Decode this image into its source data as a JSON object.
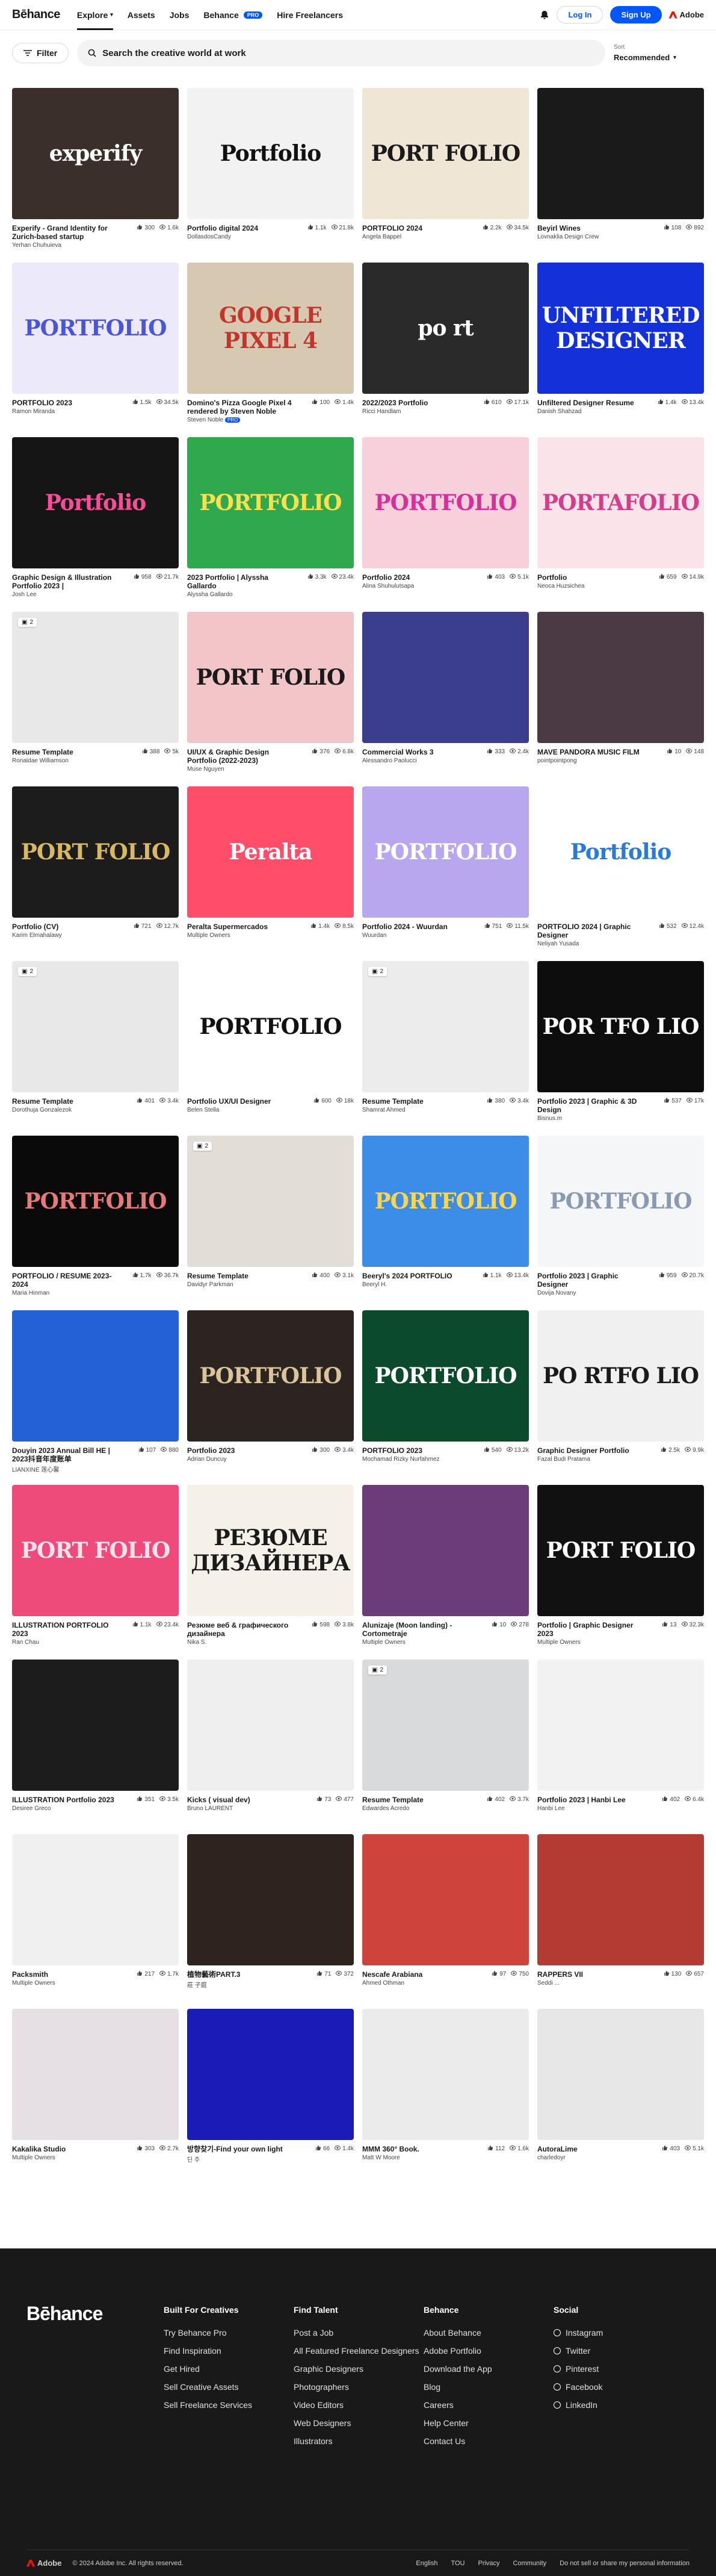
{
  "header": {
    "logo": "Bēhance",
    "nav": [
      {
        "label": "Explore",
        "active": true
      },
      {
        "label": "Assets"
      },
      {
        "label": "Jobs"
      },
      {
        "label": "Behance",
        "badge": "PRO"
      },
      {
        "label": "Hire Freelancers"
      }
    ],
    "login": "Log In",
    "signup": "Sign Up",
    "adobe": "Adobe"
  },
  "search": {
    "filter": "Filter",
    "placeholder": "Search the creative world at work",
    "sort_label": "Sort",
    "sort_value": "Recommended"
  },
  "cards": [
    {
      "title": "Experify - Grand Identity for Zurich-based startup",
      "owner": "Yerhan Chuhuieva",
      "likes": "300",
      "views": "1.6k",
      "bg": "#3a2f2a",
      "text": "experify",
      "fg": "#ffffff"
    },
    {
      "title": "Portfolio digital 2024",
      "owner": "DollasdosCandy",
      "likes": "1.1k",
      "views": "21.8k",
      "bg": "#f2f2f2",
      "text": "Portfolio",
      "fg": "#111111"
    },
    {
      "title": "PORTFOLIO 2024",
      "owner": "Angela Bappel",
      "likes": "2.2k",
      "views": "34.5k",
      "bg": "#efe6d6",
      "text": "PORT FOLIO",
      "fg": "#1a1a1a"
    },
    {
      "title": "Beyirl Wines",
      "owner": "Lovnaklia Design Crew",
      "likes": "108",
      "views": "892",
      "bg": "#1a1a1a",
      "text": "",
      "fg": "#ffffff"
    },
    {
      "title": "PORTFOLIO 2023",
      "owner": "Ramon Miranda",
      "likes": "1.5k",
      "views": "34.5k",
      "bg": "#eceafa",
      "text": "PORTFOLIO",
      "fg": "#4b55d8"
    },
    {
      "title": "Domino's Pizza Google Pixel 4 rendered by Steven Noble",
      "owner": "Steven Noble",
      "likes": "100",
      "views": "1.4k",
      "bg": "#d7c8b2",
      "text": "GOOGLE PIXEL 4",
      "fg": "#c4342b",
      "multi": "PRO"
    },
    {
      "title": "2022/2023 Portfolio",
      "owner": "Ricci Handlam",
      "likes": "610",
      "views": "17.1k",
      "bg": "#2a2a2a",
      "text": "po rt",
      "fg": "#ffffff"
    },
    {
      "title": "Unfiltered Designer Resume",
      "owner": "Danish Shahzad",
      "likes": "1.4k",
      "views": "13.4k",
      "bg": "#1330d9",
      "text": "UNFILTERED DESIGNER",
      "fg": "#ffffff"
    },
    {
      "title": "Graphic Design & Illustration Portfolio 2023 |",
      "owner": "Josh Lee",
      "likes": "958",
      "views": "21.7k",
      "bg": "#151515",
      "text": "Portfolio",
      "fg": "#ff4c9a"
    },
    {
      "title": "2023 Portfolio | Alyssha Gallardo",
      "owner": "Alyssha Gallardo",
      "likes": "3.3k",
      "views": "23.4k",
      "bg": "#2fa84e",
      "text": "PORTFOLIO",
      "fg": "#ffe04a"
    },
    {
      "title": "Portfolio 2024",
      "owner": "Alina Shuhulutsapa",
      "likes": "403",
      "views": "5.1k",
      "bg": "#f7d0dc",
      "text": "PORTFOLIO",
      "fg": "#d6319b"
    },
    {
      "title": "Portfolio",
      "owner": "Neoca Huzsichea",
      "likes": "659",
      "views": "14.9k",
      "bg": "#fbe3ea",
      "text": "PORTAFOLIO",
      "fg": "#d43d8a"
    },
    {
      "title": "Resume Template",
      "owner": "Ronaldae Williamson",
      "likes": "388",
      "views": "5k",
      "bg": "#e8e8e8",
      "text": "",
      "fg": "#333333",
      "pages": "2"
    },
    {
      "title": "UI/UX & Graphic Design Portfolio (2022-2023)",
      "owner": "Muse Nguyen",
      "likes": "376",
      "views": "6.8k",
      "bg": "#f2c6c8",
      "text": "PORT FOLIO",
      "fg": "#1a1a1a"
    },
    {
      "title": "Commercial Works 3",
      "owner": "Alessandro Paolucci",
      "likes": "333",
      "views": "2.4k",
      "bg": "#3a3e8c",
      "text": "",
      "fg": "#ffffff"
    },
    {
      "title": "MAVE PANDORA MUSIC FILM",
      "owner": "pointpointpong",
      "likes": "10",
      "views": "148",
      "bg": "#4b3a44",
      "text": "",
      "fg": "#ffffff"
    },
    {
      "title": "Portfolio (CV)",
      "owner": "Karim Elmahalawy",
      "likes": "721",
      "views": "12.7k",
      "bg": "#1c1c1c",
      "text": "PORT FOLIO",
      "fg": "#d8b862"
    },
    {
      "title": "Peralta Supermercados",
      "owner": "Multiple Owners",
      "likes": "1.4k",
      "views": "8.5k",
      "bg": "#ff4d6a",
      "text": "Peralta",
      "fg": "#ffffff"
    },
    {
      "title": "Portfolio 2024 - Wuurdan",
      "owner": "Wuurdan",
      "likes": "751",
      "views": "11.5k",
      "bg": "#b8a7ef",
      "text": "PORTFOLIO",
      "fg": "#ffffff"
    },
    {
      "title": "PORTFOLIO 2024 | Graphic Designer",
      "owner": "Neliyah Yusada",
      "likes": "532",
      "views": "12.4k",
      "bg": "#ffffff",
      "text": "Portfolio",
      "fg": "#2a7bd8"
    },
    {
      "title": "Resume Template",
      "owner": "Dorothuja Gonzalezok",
      "likes": "401",
      "views": "3.4k",
      "bg": "#e8e8e8",
      "text": "",
      "fg": "#333333",
      "pages": "2"
    },
    {
      "title": "Portfolio UX/UI Designer",
      "owner": "Belen Stella",
      "likes": "600",
      "views": "18k",
      "bg": "#ffffff",
      "text": "PORTFOLIO",
      "fg": "#111111"
    },
    {
      "title": "Resume Template",
      "owner": "Shamrat Ahmed",
      "likes": "380",
      "views": "3.4k",
      "bg": "#ececec",
      "text": "",
      "fg": "#333333",
      "pages": "2"
    },
    {
      "title": "Portfolio 2023 | Graphic & 3D Design",
      "owner": "Bisnus.m",
      "likes": "537",
      "views": "17k",
      "bg": "#0d0d0d",
      "text": "POR TFO LIO",
      "fg": "#ffffff"
    },
    {
      "title": "PORTFOLIO / RESUME 2023-2024",
      "owner": "Maria Hinman",
      "likes": "1.7k",
      "views": "36.7k",
      "bg": "#0a0a0a",
      "text": "PORTFOLIO",
      "fg": "#e8797a"
    },
    {
      "title": "Resume Template",
      "owner": "Davidyr Parkman",
      "likes": "400",
      "views": "3.1k",
      "bg": "#e2ddd6",
      "text": "",
      "fg": "#333333",
      "pages": "2"
    },
    {
      "title": "Beeryl's 2024 PORTFOLIO",
      "owner": "Beeryl H.",
      "likes": "1.1k",
      "views": "13.4k",
      "bg": "#3b8de8",
      "text": "PORTFOLIO",
      "fg": "#ffd64a"
    },
    {
      "title": "Portfolio 2023 | Graphic Designer",
      "owner": "Dovija Novany",
      "likes": "959",
      "views": "20.7k",
      "bg": "#f5f6f8",
      "text": "PORTFOLIO",
      "fg": "#8a9ab0"
    },
    {
      "title": "Douyin 2023 Annual Bill HE | 2023抖音年度账单",
      "owner": "LIANXINE 莲心馨",
      "likes": "107",
      "views": "880",
      "bg": "#2461d6",
      "text": "",
      "fg": "#ffffff"
    },
    {
      "title": "Portfolio 2023",
      "owner": "Adrian Duncuy",
      "likes": "300",
      "views": "3.4k",
      "bg": "#2b2421",
      "text": "PORTFOLIO",
      "fg": "#d9c49b"
    },
    {
      "title": "PORTFOLIO 2023",
      "owner": "Mochamad Rizky Nurfahmez",
      "likes": "540",
      "views": "13.2k",
      "bg": "#0c4a2c",
      "text": "PORTFOLIO",
      "fg": "#ffffff"
    },
    {
      "title": "Graphic Designer Portfolio",
      "owner": "Fazal Budi Pratama",
      "likes": "2.5k",
      "views": "9.9k",
      "bg": "#f0f0f0",
      "text": "PO RTFO LIO",
      "fg": "#1a1a1a"
    },
    {
      "title": "ILLUSTRATION PORTFOLIO 2023",
      "owner": "Ran Chau",
      "likes": "1.1k",
      "views": "23.4k",
      "bg": "#ee4b7a",
      "text": "PORT FOLIO",
      "fg": "#ffe3ec"
    },
    {
      "title": "Резюме веб & графического дизайнера",
      "owner": "Nika S.",
      "likes": "598",
      "views": "3.8k",
      "bg": "#f5f1e8",
      "text": "РЕЗЮМЕ ДИЗАЙНЕРА",
      "fg": "#1a1a1a"
    },
    {
      "title": "Alunizaje (Moon landing) - Cortometraje",
      "owner": "Multiple Owners",
      "likes": "10",
      "views": "278",
      "bg": "#6b3b7a",
      "text": "",
      "fg": "#ffffff"
    },
    {
      "title": "Portfolio | Graphic Designer 2023",
      "owner": "Multiple Owners",
      "likes": "13",
      "views": "32.3k",
      "bg": "#111111",
      "text": "PORT FOLIO",
      "fg": "#ffffff"
    },
    {
      "title": "ILLUSTRATION Portfolio 2023",
      "owner": "Desiree Greco",
      "likes": "351",
      "views": "3.5k",
      "bg": "#1c1c1c",
      "text": "",
      "fg": "#ffffff"
    },
    {
      "title": "Kicks ( visual dev)",
      "owner": "Bruno LAURENT",
      "likes": "73",
      "views": "477",
      "bg": "#efefef",
      "text": "",
      "fg": "#333333"
    },
    {
      "title": "Resume Template",
      "owner": "Edwardes Acredo",
      "likes": "402",
      "views": "3.7k",
      "bg": "#d9dadc",
      "text": "",
      "fg": "#333333",
      "pages": "2"
    },
    {
      "title": "Portfolio 2023 | Hanbi Lee",
      "owner": "Hanbi Lee",
      "likes": "402",
      "views": "6.4k",
      "bg": "#f2f2f2",
      "text": "",
      "fg": "#333333"
    },
    {
      "title": "Packsmith",
      "owner": "Multiple Owners",
      "likes": "217",
      "views": "1.7k",
      "bg": "#f0f0f0",
      "text": "",
      "fg": "#333333"
    },
    {
      "title": "植物藝術PART.3",
      "owner": "莊 子庭",
      "likes": "71",
      "views": "372",
      "bg": "#2e231e",
      "text": "",
      "fg": "#ffffff"
    },
    {
      "title": "Nescafe Arabiana",
      "owner": "Ahmed Othman",
      "likes": "97",
      "views": "750",
      "bg": "#cf433d",
      "text": "",
      "fg": "#ffffff"
    },
    {
      "title": "RAPPERS VII",
      "owner": "Seddi ...",
      "likes": "130",
      "views": "657",
      "bg": "#b43a34",
      "text": "",
      "fg": "#ffffff"
    },
    {
      "title": "Kakalika Studio",
      "owner": "Multiple Owners",
      "likes": "303",
      "views": "2.7k",
      "bg": "#e6dfe3",
      "text": "",
      "fg": "#333333"
    },
    {
      "title": "방향찾기-Find your own light",
      "owner": "딘 주",
      "likes": "66",
      "views": "1.4k",
      "bg": "#1a1cb8",
      "text": "",
      "fg": "#ffffff"
    },
    {
      "title": "MMM 360° Book.",
      "owner": "Matt W Moore",
      "likes": "112",
      "views": "1.6k",
      "bg": "#ebebeb",
      "text": "",
      "fg": "#333333"
    },
    {
      "title": "AutoraLime",
      "owner": "charledoyr",
      "likes": "403",
      "views": "5.1k",
      "bg": "#e7e7e7",
      "text": "",
      "fg": "#333333"
    }
  ],
  "footer": {
    "logo": "Bēhance",
    "cols": [
      {
        "heading": "Built For Creatives",
        "links": [
          "Try Behance Pro",
          "Find Inspiration",
          "Get Hired",
          "Sell Creative Assets",
          "Sell Freelance Services"
        ]
      },
      {
        "heading": "Find Talent",
        "links": [
          "Post a Job",
          "All Featured Freelance Designers",
          "Graphic Designers",
          "Photographers",
          "Video Editors",
          "Web Designers",
          "Illustrators"
        ]
      },
      {
        "heading": "Behance",
        "links": [
          "About Behance",
          "Adobe Portfolio",
          "Download the App",
          "Blog",
          "Careers",
          "Help Center",
          "Contact Us"
        ]
      },
      {
        "heading": "Social",
        "links": [
          "Instagram",
          "Twitter",
          "Pinterest",
          "Facebook",
          "LinkedIn"
        ]
      }
    ],
    "adobe": "Adobe",
    "copyright": "© 2024 Adobe Inc. All rights reserved.",
    "language": "English",
    "tou": "TOU",
    "privacy": "Privacy",
    "community": "Community",
    "dnsell": "Do not sell or share my personal information"
  }
}
